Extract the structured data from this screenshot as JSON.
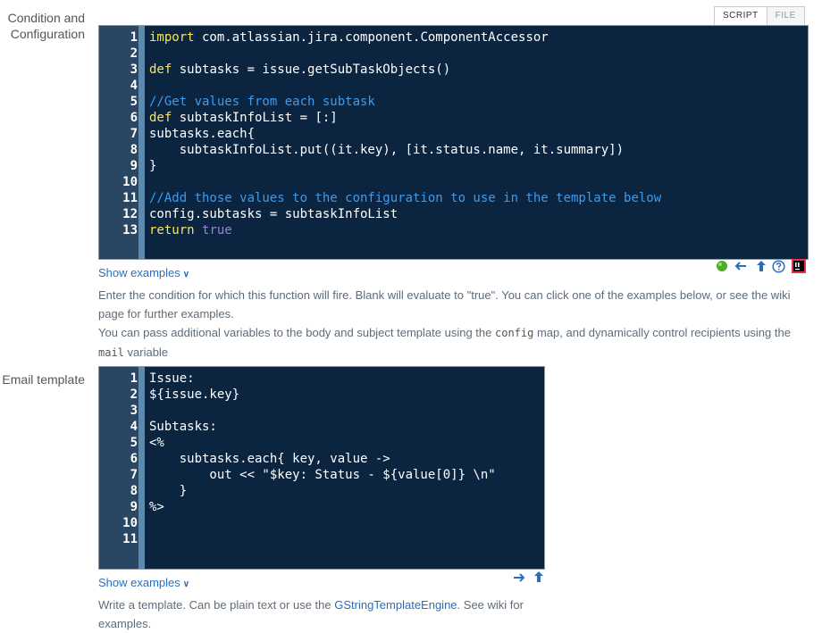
{
  "tabs": {
    "script": "SCRIPT",
    "file": "FILE"
  },
  "condition": {
    "label_line1": "Condition and",
    "label_line2": "Configuration",
    "lines": [
      {
        "n": "1",
        "segs": [
          {
            "t": "import",
            "c": "kw"
          },
          {
            "t": " com.atlassian.jira.component.ComponentAccessor",
            "c": ""
          }
        ]
      },
      {
        "n": "2",
        "segs": []
      },
      {
        "n": "3",
        "segs": [
          {
            "t": "def",
            "c": "kw"
          },
          {
            "t": " subtasks = issue.getSubTaskObjects()",
            "c": ""
          }
        ]
      },
      {
        "n": "4",
        "segs": []
      },
      {
        "n": "5",
        "segs": [
          {
            "t": "//Get values from each subtask",
            "c": "cm"
          }
        ]
      },
      {
        "n": "6",
        "segs": [
          {
            "t": "def",
            "c": "kw"
          },
          {
            "t": " subtaskInfoList = [:]",
            "c": ""
          }
        ]
      },
      {
        "n": "7",
        "segs": [
          {
            "t": "subtasks.each{",
            "c": ""
          }
        ]
      },
      {
        "n": "8",
        "segs": [
          {
            "t": "    subtaskInfoList.put((it.key), [it.status.name, it.summary])",
            "c": ""
          }
        ]
      },
      {
        "n": "9",
        "segs": [
          {
            "t": "}",
            "c": ""
          }
        ]
      },
      {
        "n": "10",
        "segs": []
      },
      {
        "n": "11",
        "segs": [
          {
            "t": "//Add those values to the configuration to use in the template below",
            "c": "cm"
          }
        ]
      },
      {
        "n": "12",
        "segs": [
          {
            "t": "config.subtasks = subtaskInfoList",
            "c": ""
          }
        ]
      },
      {
        "n": "13",
        "segs": [
          {
            "t": "return",
            "c": "kw"
          },
          {
            "t": " ",
            "c": ""
          },
          {
            "t": "true",
            "c": "bool"
          }
        ]
      }
    ],
    "show_examples": "Show examples",
    "help_p1": "Enter the condition for which this function will fire. Blank will evaluate to \"true\". You can click one of the examples below, or see the wiki page for further examples.",
    "help_p2_a": "You can pass additional variables to the body and subject template using the ",
    "help_p2_code1": "config",
    "help_p2_b": " map, and dynamically control recipients using the ",
    "help_p2_code2": "mail",
    "help_p2_c": " variable"
  },
  "email": {
    "label": "Email template",
    "lines": [
      {
        "n": "1",
        "segs": [
          {
            "t": "Issue:",
            "c": ""
          }
        ]
      },
      {
        "n": "2",
        "segs": [
          {
            "t": "${issue.key}",
            "c": ""
          }
        ]
      },
      {
        "n": "3",
        "segs": []
      },
      {
        "n": "4",
        "segs": [
          {
            "t": "Subtasks:",
            "c": ""
          }
        ]
      },
      {
        "n": "5",
        "segs": [
          {
            "t": "<%",
            "c": ""
          }
        ]
      },
      {
        "n": "6",
        "segs": [
          {
            "t": "    subtasks.each{ key, value ->",
            "c": ""
          }
        ]
      },
      {
        "n": "7",
        "segs": [
          {
            "t": "        out << \"$key: Status - ${value[0]} \\n\"",
            "c": ""
          }
        ]
      },
      {
        "n": "8",
        "segs": [
          {
            "t": "    }",
            "c": ""
          }
        ]
      },
      {
        "n": "9",
        "segs": [
          {
            "t": "%>",
            "c": ""
          }
        ]
      },
      {
        "n": "10",
        "segs": []
      },
      {
        "n": "11",
        "segs": []
      }
    ],
    "show_examples": "Show examples",
    "help_a": "Write a template. Can be plain text or use the ",
    "help_link": "GStringTemplateEngine",
    "help_b": ". See wiki for examples."
  },
  "icons": {
    "condition_toolbar": [
      "status-ok-icon",
      "arrow-left-icon",
      "revert-icon",
      "help-icon",
      "intellij-icon"
    ],
    "email_toolbar": [
      "arrow-right-icon",
      "revert-icon"
    ]
  },
  "colors": {
    "editor_bg": "#0b2540",
    "keyword": "#f9e45b",
    "comment": "#3a9cf0",
    "boolean": "#9d7fe0",
    "link": "#2a6ebb",
    "ok": "#4caf28"
  }
}
